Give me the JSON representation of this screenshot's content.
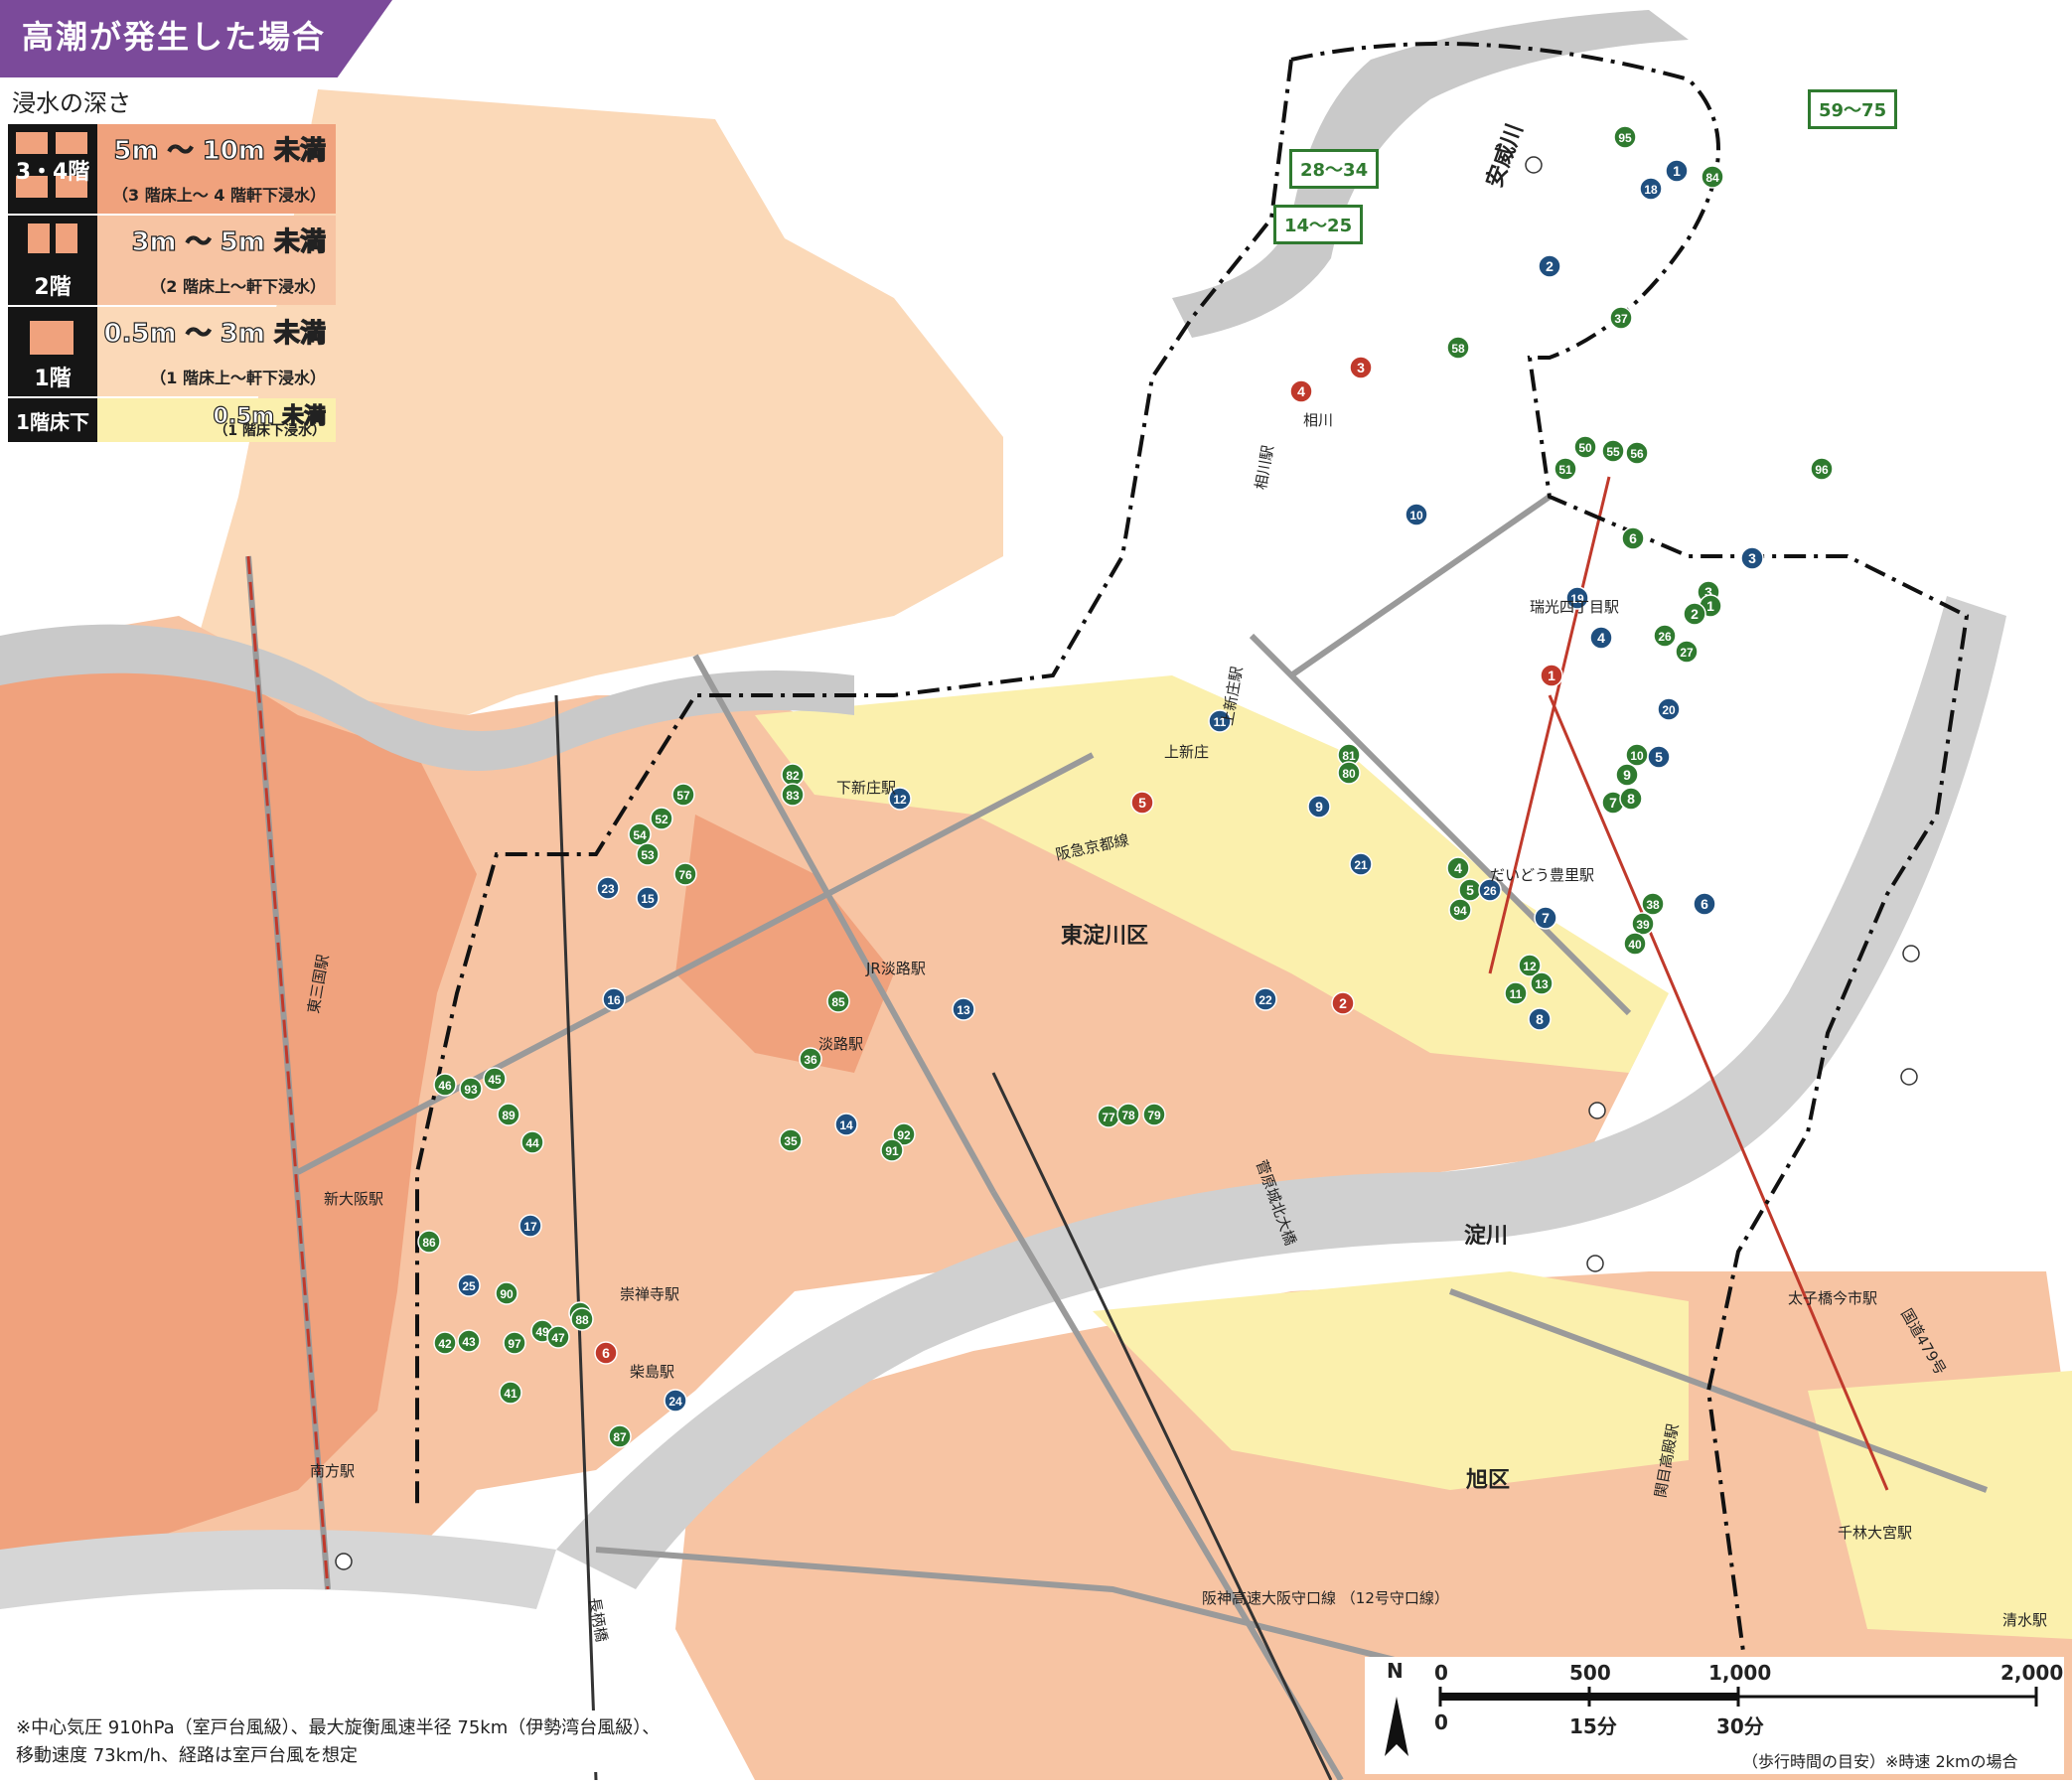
{
  "title": "高潮が発生した場合",
  "legend": {
    "heading": "浸水の深さ",
    "rows": [
      {
        "floor": "3・4階",
        "depth": "5m ～ 10m 未満",
        "desc": "（3 階床上～ 4 階軒下浸水）",
        "color": "#f0a27d"
      },
      {
        "floor": "2階",
        "depth": "3m ～ 5m 未満",
        "desc": "（2 階床上～軒下浸水）",
        "color": "#f7c4a3"
      },
      {
        "floor": "1階",
        "depth": "0.5m ～ 3m 未満",
        "desc": "（1 階床上～軒下浸水）",
        "color": "#fbd9b8"
      },
      {
        "floor": "1階床下",
        "depth": "0.5m 未満",
        "desc": "（1 階床下浸水）",
        "color": "#fbf0ad"
      }
    ]
  },
  "callouts": {
    "c1": "14～25",
    "c2": "28～34",
    "c3": "59～75"
  },
  "markers": [
    {
      "n": "95",
      "c": "g"
    },
    {
      "n": "84",
      "c": "g"
    },
    {
      "n": "18",
      "c": "b"
    },
    {
      "n": "1",
      "c": "b"
    },
    {
      "n": "2",
      "c": "b"
    },
    {
      "n": "37",
      "c": "g"
    },
    {
      "n": "58",
      "c": "g"
    },
    {
      "n": "4",
      "c": "r"
    },
    {
      "n": "3",
      "c": "r"
    },
    {
      "n": "50",
      "c": "g"
    },
    {
      "n": "55",
      "c": "g"
    },
    {
      "n": "56",
      "c": "g"
    },
    {
      "n": "51",
      "c": "g"
    },
    {
      "n": "96",
      "c": "g"
    },
    {
      "n": "10",
      "c": "b"
    },
    {
      "n": "6",
      "c": "g"
    },
    {
      "n": "3",
      "c": "b"
    },
    {
      "n": "3",
      "c": "g"
    },
    {
      "n": "1",
      "c": "g"
    },
    {
      "n": "2",
      "c": "g"
    },
    {
      "n": "19",
      "c": "b"
    },
    {
      "n": "4",
      "c": "b"
    },
    {
      "n": "26",
      "c": "g"
    },
    {
      "n": "27",
      "c": "g"
    },
    {
      "n": "1",
      "c": "r"
    },
    {
      "n": "20",
      "c": "b"
    },
    {
      "n": "10",
      "c": "g"
    },
    {
      "n": "5",
      "c": "b"
    },
    {
      "n": "9",
      "c": "g"
    },
    {
      "n": "7",
      "c": "g"
    },
    {
      "n": "8",
      "c": "g"
    },
    {
      "n": "11",
      "c": "b"
    },
    {
      "n": "81",
      "c": "g"
    },
    {
      "n": "80",
      "c": "g"
    },
    {
      "n": "5",
      "c": "r"
    },
    {
      "n": "9",
      "c": "b"
    },
    {
      "n": "82",
      "c": "g"
    },
    {
      "n": "83",
      "c": "g"
    },
    {
      "n": "12",
      "c": "b"
    },
    {
      "n": "57",
      "c": "g"
    },
    {
      "n": "54",
      "c": "g"
    },
    {
      "n": "52",
      "c": "g"
    },
    {
      "n": "53",
      "c": "g"
    },
    {
      "n": "76",
      "c": "g"
    },
    {
      "n": "23",
      "c": "b"
    },
    {
      "n": "15",
      "c": "b"
    },
    {
      "n": "21",
      "c": "b"
    },
    {
      "n": "4",
      "c": "g"
    },
    {
      "n": "5",
      "c": "g"
    },
    {
      "n": "26",
      "c": "b"
    },
    {
      "n": "94",
      "c": "g"
    },
    {
      "n": "6",
      "c": "b"
    },
    {
      "n": "38",
      "c": "g"
    },
    {
      "n": "39",
      "c": "g"
    },
    {
      "n": "40",
      "c": "g"
    },
    {
      "n": "7",
      "c": "b"
    },
    {
      "n": "12",
      "c": "g"
    },
    {
      "n": "11",
      "c": "g"
    },
    {
      "n": "13",
      "c": "g"
    },
    {
      "n": "8",
      "c": "b"
    },
    {
      "n": "22",
      "c": "b"
    },
    {
      "n": "2",
      "c": "r"
    },
    {
      "n": "16",
      "c": "b"
    },
    {
      "n": "13",
      "c": "b"
    },
    {
      "n": "85",
      "c": "g"
    },
    {
      "n": "36",
      "c": "g"
    },
    {
      "n": "46",
      "c": "g"
    },
    {
      "n": "93",
      "c": "g"
    },
    {
      "n": "45",
      "c": "g"
    },
    {
      "n": "89",
      "c": "g"
    },
    {
      "n": "44",
      "c": "g"
    },
    {
      "n": "14",
      "c": "b"
    },
    {
      "n": "35",
      "c": "g"
    },
    {
      "n": "92",
      "c": "g"
    },
    {
      "n": "91",
      "c": "g"
    },
    {
      "n": "77",
      "c": "g"
    },
    {
      "n": "78",
      "c": "g"
    },
    {
      "n": "79",
      "c": "g"
    },
    {
      "n": "17",
      "c": "b"
    },
    {
      "n": "86",
      "c": "g"
    },
    {
      "n": "25",
      "c": "b"
    },
    {
      "n": "90",
      "c": "g"
    },
    {
      "n": "48",
      "c": "g"
    },
    {
      "n": "49",
      "c": "g"
    },
    {
      "n": "47",
      "c": "g"
    },
    {
      "n": "88",
      "c": "g"
    },
    {
      "n": "42",
      "c": "g"
    },
    {
      "n": "43",
      "c": "g"
    },
    {
      "n": "97",
      "c": "g"
    },
    {
      "n": "6",
      "c": "r"
    },
    {
      "n": "41",
      "c": "g"
    },
    {
      "n": "24",
      "c": "b"
    },
    {
      "n": "87",
      "c": "g"
    }
  ],
  "places": {
    "ajigawa": "安威川",
    "ai": "相川",
    "aikawa": "相川駅",
    "higashiyodogawa": "東淀川区",
    "yodogawa": "淀川",
    "asahi": "旭区",
    "shinosaka": "新大阪駅",
    "kamishinjo": "上新庄駅",
    "shimoshinjo": "下新庄駅",
    "awaji": "淡路駅",
    "jrawaji": "JR淡路駅",
    "sugahara": "菅原城北大橋",
    "hankyu": "阪急京都線",
    "daido": "だいどう豊里駅",
    "zuiko": "瑞光四丁目駅",
    "sozenji": "崇禅寺駅",
    "shibashima": "柴島駅",
    "route479": "国道479号",
    "sekime": "関目高殿駅",
    "minamikata": "南方駅",
    "higashimikuni": "東三国駅",
    "nagarabashi": "長柄橋",
    "taishibashi": "太子橋今市駅",
    "hanshin": "阪神高速大阪守口線 （12号守口線）",
    "senbayashi": "千林大宮駅",
    "shimizu": "清水駅",
    "kami": "上新庄"
  },
  "note": {
    "line1": "※中心気圧 910hPa（室戸台風級）、最大旋衡風速半径 75km（伊勢湾台風級）、",
    "line2": "移動速度 73km/h、経路は室戸台風を想定"
  },
  "scale": {
    "north": "N",
    "m0": "0",
    "m500": "500",
    "m1000": "1,000",
    "m2000": "2,000",
    "t0": "0",
    "t15": "15分",
    "t30": "30分",
    "footer": "（歩行時間の目安）※時速 2kmの場合"
  },
  "colors": {
    "deep": "#f0a27d",
    "mid": "#f7c4a3",
    "shallow": "#fbd9b8",
    "floorbelow": "#fbf0ad",
    "river": "#c9c9c9"
  }
}
